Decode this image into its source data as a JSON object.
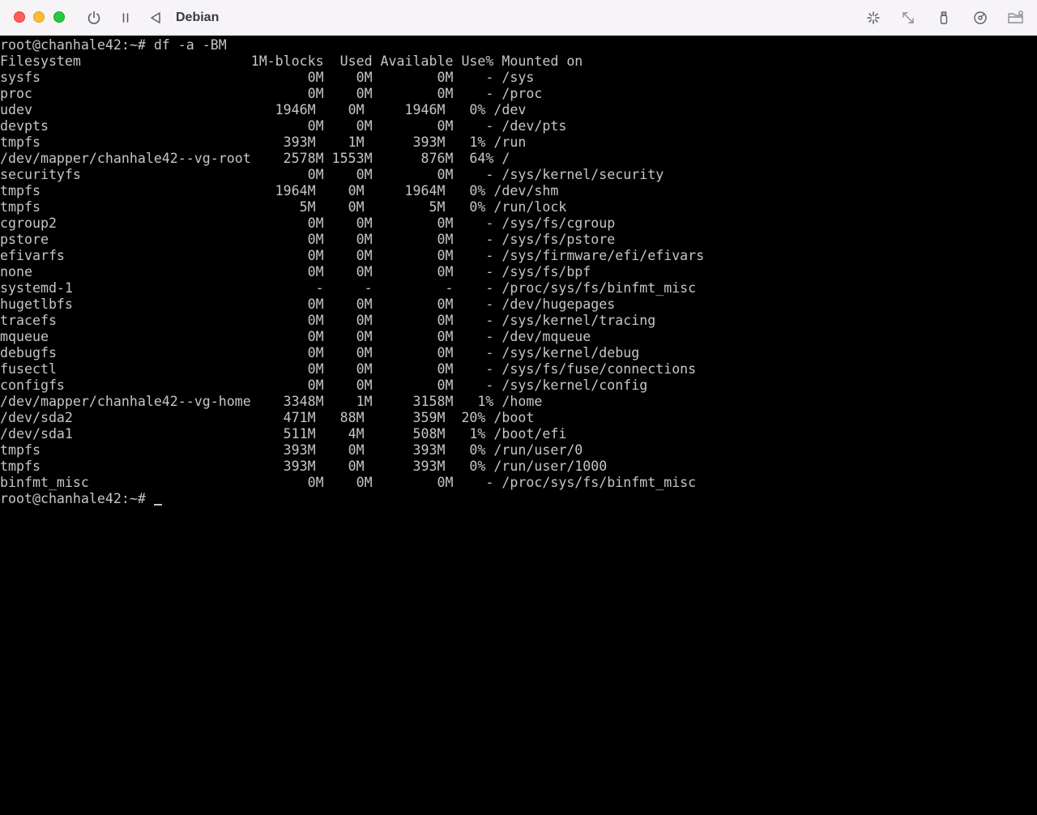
{
  "window": {
    "title": "Debian"
  },
  "toolbar_icons": [
    "power-icon",
    "pause-icon",
    "back-icon",
    "sparkle-icon",
    "resize-arrows-icon",
    "usb-icon",
    "disk-icon",
    "shared-folder-icon"
  ],
  "colors": {
    "titlebar_bg": "#f6f4f7",
    "terminal_bg": "#000000",
    "terminal_fg": "#c6c6c6",
    "close": "#ff5f57",
    "minimize": "#febc2e",
    "maximize": "#28c840"
  },
  "terminal": {
    "command_line": "root@chanhale42:~# df -a -BM",
    "header": "Filesystem                     1M-blocks  Used Available Use% Mounted on",
    "rows": [
      "sysfs                                 0M    0M        0M    - /sys",
      "proc                                  0M    0M        0M    - /proc",
      "udev                              1946M    0M     1946M   0% /dev",
      "devpts                                0M    0M        0M    - /dev/pts",
      "tmpfs                              393M    1M      393M   1% /run",
      "/dev/mapper/chanhale42--vg-root    2578M 1553M      876M  64% /",
      "securityfs                            0M    0M        0M    - /sys/kernel/security",
      "tmpfs                             1964M    0M     1964M   0% /dev/shm",
      "tmpfs                                5M    0M        5M   0% /run/lock",
      "cgroup2                               0M    0M        0M    - /sys/fs/cgroup",
      "pstore                                0M    0M        0M    - /sys/fs/pstore",
      "efivarfs                              0M    0M        0M    - /sys/firmware/efi/efivars",
      "none                                  0M    0M        0M    - /sys/fs/bpf",
      "systemd-1                              -     -         -    - /proc/sys/fs/binfmt_misc",
      "hugetlbfs                             0M    0M        0M    - /dev/hugepages",
      "tracefs                               0M    0M        0M    - /sys/kernel/tracing",
      "mqueue                                0M    0M        0M    - /dev/mqueue",
      "debugfs                               0M    0M        0M    - /sys/kernel/debug",
      "fusectl                               0M    0M        0M    - /sys/fs/fuse/connections",
      "configfs                              0M    0M        0M    - /sys/kernel/config",
      "/dev/mapper/chanhale42--vg-home    3348M    1M     3158M   1% /home",
      "/dev/sda2                          471M   88M      359M  20% /boot",
      "/dev/sda1                          511M    4M      508M   1% /boot/efi",
      "tmpfs                              393M    0M      393M   0% /run/user/0",
      "tmpfs                              393M    0M      393M   0% /run/user/1000",
      "binfmt_misc                           0M    0M        0M    - /proc/sys/fs/binfmt_misc"
    ],
    "prompt": "root@chanhale42:~# "
  }
}
